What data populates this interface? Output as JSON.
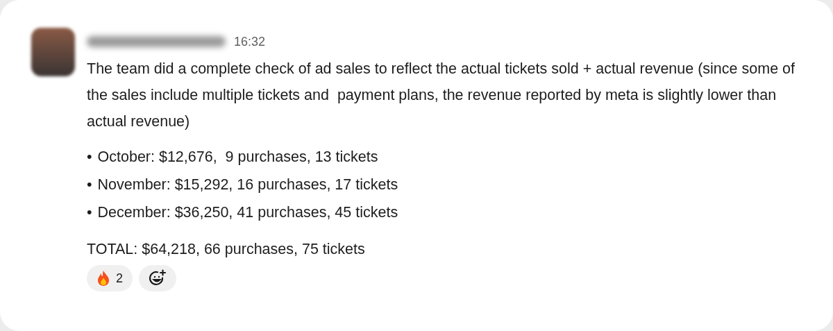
{
  "message": {
    "time": "16:32",
    "paragraph": "The team did a complete check of ad sales to reflect the actual tickets sold + actual revenue (since some of the sales include multiple tickets and  payment plans, the revenue reported by meta is slightly lower than actual revenue)",
    "bullets": [
      {
        "bullet": "•",
        "text": "October: $12,676,  9 purchases, 13 tickets"
      },
      {
        "bullet": "•",
        "text": "November: $15,292, 16 purchases, 17 tickets"
      },
      {
        "bullet": "•",
        "text": "December: $36,250, 41 purchases, 45 tickets"
      }
    ],
    "total": "TOTAL: $64,218, 66 purchases, 75 tickets",
    "reactions": [
      {
        "kind": "fire",
        "count": "2"
      },
      {
        "kind": "add"
      }
    ]
  }
}
